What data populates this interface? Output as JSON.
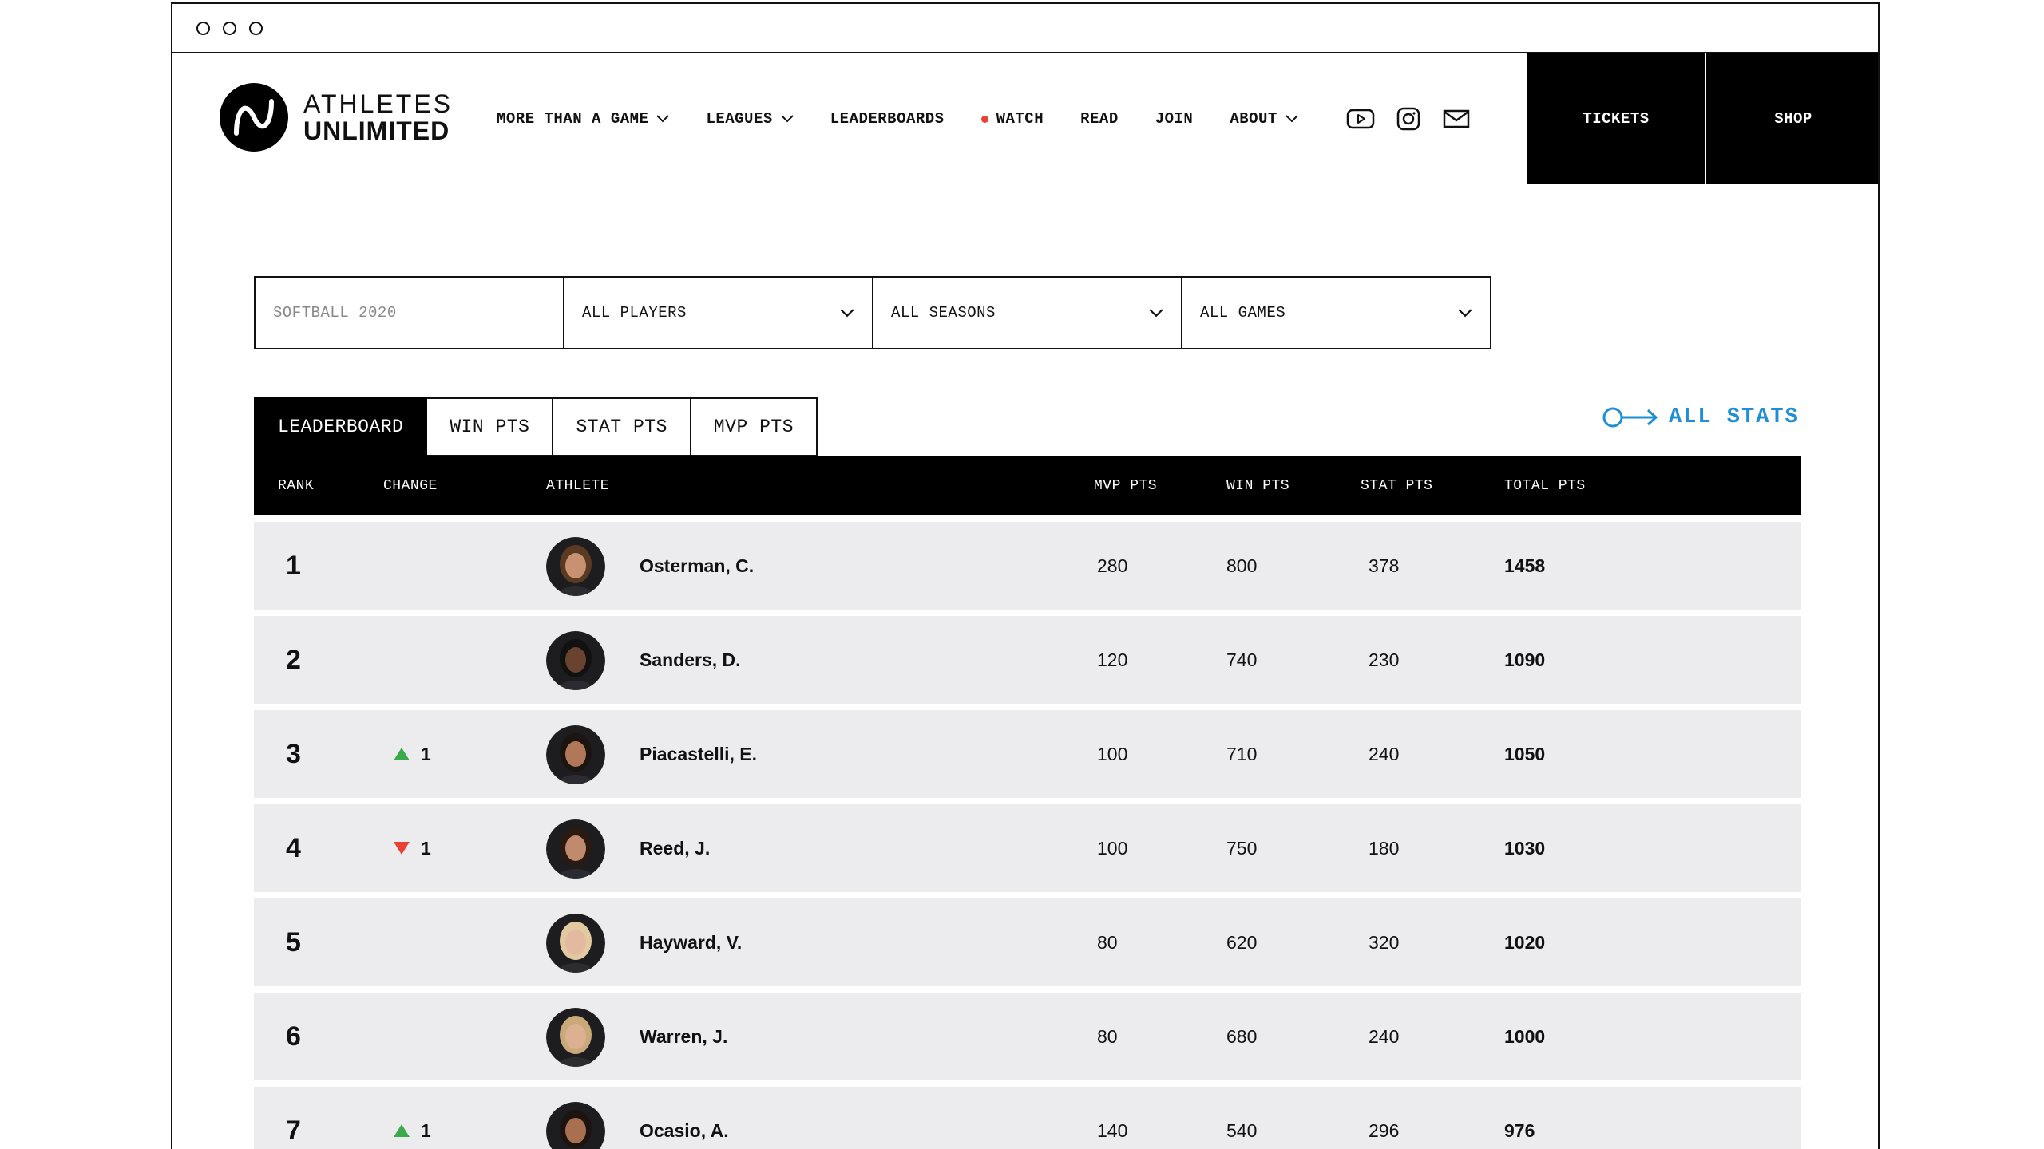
{
  "brand": {
    "line1": "ATHLETES",
    "line2": "UNLIMITED"
  },
  "nav": {
    "items": [
      {
        "label": "MORE THAN A GAME",
        "dropdown": true
      },
      {
        "label": "LEAGUES",
        "dropdown": true
      },
      {
        "label": "LEADERBOARDS",
        "dropdown": false
      },
      {
        "label": "WATCH",
        "dropdown": false,
        "live": true
      },
      {
        "label": "READ",
        "dropdown": false
      },
      {
        "label": "JOIN",
        "dropdown": false
      },
      {
        "label": "ABOUT",
        "dropdown": true
      }
    ],
    "social_icons": [
      "youtube-icon",
      "instagram-icon",
      "mail-icon"
    ],
    "tickets_label": "TICKETS",
    "shop_label": "SHOP"
  },
  "filters": {
    "league": "SOFTBALL 2020",
    "players": "ALL PLAYERS",
    "seasons": "ALL SEASONS",
    "games": "ALL GAMES"
  },
  "tabs": [
    {
      "label": "LEADERBOARD",
      "active": true
    },
    {
      "label": "WIN PTS",
      "active": false
    },
    {
      "label": "STAT PTS",
      "active": false
    },
    {
      "label": "MVP PTS",
      "active": false
    }
  ],
  "all_stats_label": "ALL STATS",
  "table": {
    "headers": {
      "rank": "RANK",
      "change": "CHANGE",
      "athlete": "ATHLETE",
      "mvp": "MVP PTS",
      "win": "WIN PTS",
      "stat": "STAT PTS",
      "total": "TOTAL PTS"
    },
    "rows": [
      {
        "rank": "1",
        "change": "",
        "dir": "",
        "name": "Osterman, C.",
        "mvp": "280",
        "win": "800",
        "stat": "378",
        "total": "1458",
        "hair": "#5a3a22",
        "skin": "#c89272"
      },
      {
        "rank": "2",
        "change": "",
        "dir": "",
        "name": "Sanders, D.",
        "mvp": "120",
        "win": "740",
        "stat": "230",
        "total": "1090",
        "hair": "#111111",
        "skin": "#6a4330"
      },
      {
        "rank": "3",
        "change": "1",
        "dir": "up",
        "name": "Piacastelli, E.",
        "mvp": "100",
        "win": "710",
        "stat": "240",
        "total": "1050",
        "hair": "#1c1410",
        "skin": "#b07858"
      },
      {
        "rank": "4",
        "change": "1",
        "dir": "down",
        "name": "Reed, J.",
        "mvp": "100",
        "win": "750",
        "stat": "180",
        "total": "1030",
        "hair": "#2a1a12",
        "skin": "#c08a6c"
      },
      {
        "rank": "5",
        "change": "",
        "dir": "",
        "name": "Hayward, V.",
        "mvp": "80",
        "win": "620",
        "stat": "320",
        "total": "1020",
        "hair": "#e2c9a0",
        "skin": "#e3b9a0"
      },
      {
        "rank": "6",
        "change": "",
        "dir": "",
        "name": "Warren, J.",
        "mvp": "80",
        "win": "680",
        "stat": "240",
        "total": "1000",
        "hair": "#c9a87a",
        "skin": "#deb092"
      },
      {
        "rank": "7",
        "change": "1",
        "dir": "up",
        "name": "Ocasio, A.",
        "mvp": "140",
        "win": "540",
        "stat": "296",
        "total": "976",
        "hair": "#1c1410",
        "skin": "#a87050"
      }
    ]
  },
  "colors": {
    "accent": "#1e8fd6",
    "up": "#3aaa4a",
    "down": "#e94235",
    "row_bg": "#ececef"
  }
}
